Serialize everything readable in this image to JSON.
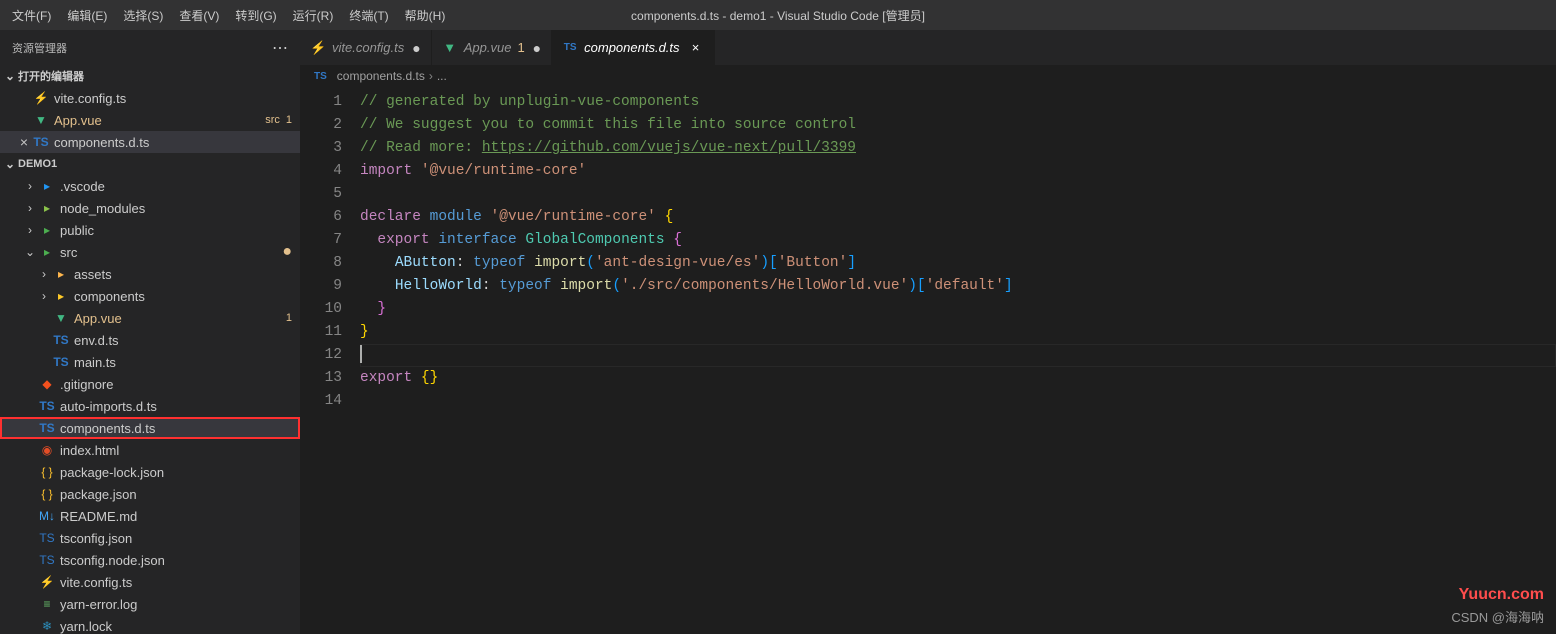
{
  "titlebar": {
    "menus": [
      "文件(F)",
      "编辑(E)",
      "选择(S)",
      "查看(V)",
      "转到(G)",
      "运行(R)",
      "终端(T)",
      "帮助(H)"
    ],
    "title": "components.d.ts - demo1 - Visual Studio Code [管理员]"
  },
  "explorer": {
    "title": "资源管理器",
    "openEditors": {
      "label": "打开的编辑器",
      "items": [
        {
          "icon": "ic-vite",
          "label": "vite.config.ts",
          "modified": false
        },
        {
          "icon": "ic-vue",
          "label": "App.vue",
          "meta": "src",
          "modified": true,
          "modCount": "1"
        },
        {
          "icon": "ic-ts",
          "label": "components.d.ts",
          "active": true
        }
      ]
    },
    "project": {
      "label": "DEMO1",
      "tree": [
        {
          "depth": 1,
          "chev": "›",
          "icon": "ic-folder-vsc",
          "label": ".vscode",
          "folder": true
        },
        {
          "depth": 1,
          "chev": "›",
          "icon": "ic-folder-nm",
          "label": "node_modules",
          "folder": true
        },
        {
          "depth": 1,
          "chev": "›",
          "icon": "ic-folder-pub",
          "label": "public",
          "folder": true
        },
        {
          "depth": 1,
          "chev": "⌄",
          "icon": "ic-folder-src",
          "label": "src",
          "folder": true,
          "dot": true
        },
        {
          "depth": 2,
          "chev": "›",
          "icon": "ic-folder-ass",
          "label": "assets",
          "folder": true
        },
        {
          "depth": 2,
          "chev": "›",
          "icon": "ic-folder-cmp",
          "label": "components",
          "folder": true
        },
        {
          "depth": 2,
          "chev": "",
          "icon": "ic-vue",
          "label": "App.vue",
          "modified": true,
          "modCount": "1"
        },
        {
          "depth": 2,
          "chev": "",
          "icon": "ic-ts",
          "label": "env.d.ts"
        },
        {
          "depth": 2,
          "chev": "",
          "icon": "ic-ts",
          "label": "main.ts"
        },
        {
          "depth": 1,
          "chev": "",
          "icon": "ic-git",
          "label": ".gitignore"
        },
        {
          "depth": 1,
          "chev": "",
          "icon": "ic-ts",
          "label": "auto-imports.d.ts"
        },
        {
          "depth": 1,
          "chev": "",
          "icon": "ic-ts",
          "label": "components.d.ts",
          "selected": true,
          "hl": true
        },
        {
          "depth": 1,
          "chev": "",
          "icon": "ic-html",
          "label": "index.html"
        },
        {
          "depth": 1,
          "chev": "",
          "icon": "ic-json",
          "label": "package-lock.json"
        },
        {
          "depth": 1,
          "chev": "",
          "icon": "ic-json",
          "label": "package.json"
        },
        {
          "depth": 1,
          "chev": "",
          "icon": "ic-md",
          "label": "README.md"
        },
        {
          "depth": 1,
          "chev": "",
          "icon": "ic-tsconf",
          "label": "tsconfig.json"
        },
        {
          "depth": 1,
          "chev": "",
          "icon": "ic-tsconf",
          "label": "tsconfig.node.json"
        },
        {
          "depth": 1,
          "chev": "",
          "icon": "ic-vite",
          "label": "vite.config.ts"
        },
        {
          "depth": 1,
          "chev": "",
          "icon": "ic-log",
          "label": "yarn-error.log"
        },
        {
          "depth": 1,
          "chev": "",
          "icon": "ic-yarn",
          "label": "yarn.lock"
        }
      ]
    }
  },
  "tabs": [
    {
      "icon": "ic-vite",
      "label": "vite.config.ts",
      "state": "dot"
    },
    {
      "icon": "ic-vue",
      "label": "App.vue",
      "mod": "1",
      "state": "dot"
    },
    {
      "icon": "ic-ts",
      "label": "components.d.ts",
      "active": true,
      "state": "close"
    }
  ],
  "breadcrumb": {
    "icon": "TS",
    "file": "components.d.ts",
    "rest": "..."
  },
  "code": {
    "lines": [
      [
        {
          "c": "tok-comment",
          "t": "// generated by unplugin-vue-components"
        }
      ],
      [
        {
          "c": "tok-comment",
          "t": "// We suggest you to commit this file into source control"
        }
      ],
      [
        {
          "c": "tok-comment",
          "t": "// Read more: "
        },
        {
          "c": "tok-link",
          "t": "https://github.com/vuejs/vue-next/pull/3399"
        }
      ],
      [
        {
          "c": "tok-keyword",
          "t": "import"
        },
        {
          "c": "tok-punc",
          "t": " "
        },
        {
          "c": "tok-string",
          "t": "'@vue/runtime-core'"
        }
      ],
      [],
      [
        {
          "c": "tok-keyword",
          "t": "declare"
        },
        {
          "c": "tok-punc",
          "t": " "
        },
        {
          "c": "tok-decl",
          "t": "module"
        },
        {
          "c": "tok-punc",
          "t": " "
        },
        {
          "c": "tok-string",
          "t": "'@vue/runtime-core'"
        },
        {
          "c": "tok-punc",
          "t": " "
        },
        {
          "c": "tok-brace1",
          "t": "{"
        }
      ],
      [
        {
          "c": "tok-punc",
          "t": "  "
        },
        {
          "c": "tok-keyword",
          "t": "export"
        },
        {
          "c": "tok-punc",
          "t": " "
        },
        {
          "c": "tok-decl",
          "t": "interface"
        },
        {
          "c": "tok-punc",
          "t": " "
        },
        {
          "c": "tok-type",
          "t": "GlobalComponents"
        },
        {
          "c": "tok-punc",
          "t": " "
        },
        {
          "c": "tok-brace2",
          "t": "{"
        }
      ],
      [
        {
          "c": "tok-punc",
          "t": "    "
        },
        {
          "c": "tok-var",
          "t": "AButton"
        },
        {
          "c": "tok-punc",
          "t": ": "
        },
        {
          "c": "tok-decl",
          "t": "typeof "
        },
        {
          "c": "tok-func",
          "t": "import"
        },
        {
          "c": "tok-brace3",
          "t": "("
        },
        {
          "c": "tok-string",
          "t": "'ant-design-vue/es'"
        },
        {
          "c": "tok-brace3",
          "t": ")["
        },
        {
          "c": "tok-string",
          "t": "'Button'"
        },
        {
          "c": "tok-brace3",
          "t": "]"
        }
      ],
      [
        {
          "c": "tok-punc",
          "t": "    "
        },
        {
          "c": "tok-var",
          "t": "HelloWorld"
        },
        {
          "c": "tok-punc",
          "t": ": "
        },
        {
          "c": "tok-decl",
          "t": "typeof "
        },
        {
          "c": "tok-func",
          "t": "import"
        },
        {
          "c": "tok-brace3",
          "t": "("
        },
        {
          "c": "tok-string",
          "t": "'./src/components/HelloWorld.vue'"
        },
        {
          "c": "tok-brace3",
          "t": ")["
        },
        {
          "c": "tok-string",
          "t": "'default'"
        },
        {
          "c": "tok-brace3",
          "t": "]"
        }
      ],
      [
        {
          "c": "tok-punc",
          "t": "  "
        },
        {
          "c": "tok-brace2",
          "t": "}"
        }
      ],
      [
        {
          "c": "tok-brace1",
          "t": "}"
        }
      ],
      [
        {
          "c": "cursor",
          "t": ""
        }
      ],
      [
        {
          "c": "tok-keyword",
          "t": "export"
        },
        {
          "c": "tok-punc",
          "t": " "
        },
        {
          "c": "tok-brace1",
          "t": "{}"
        }
      ],
      []
    ]
  },
  "watermarks": {
    "top": "Yuucn.com",
    "bottom": "CSDN @海海呐"
  }
}
